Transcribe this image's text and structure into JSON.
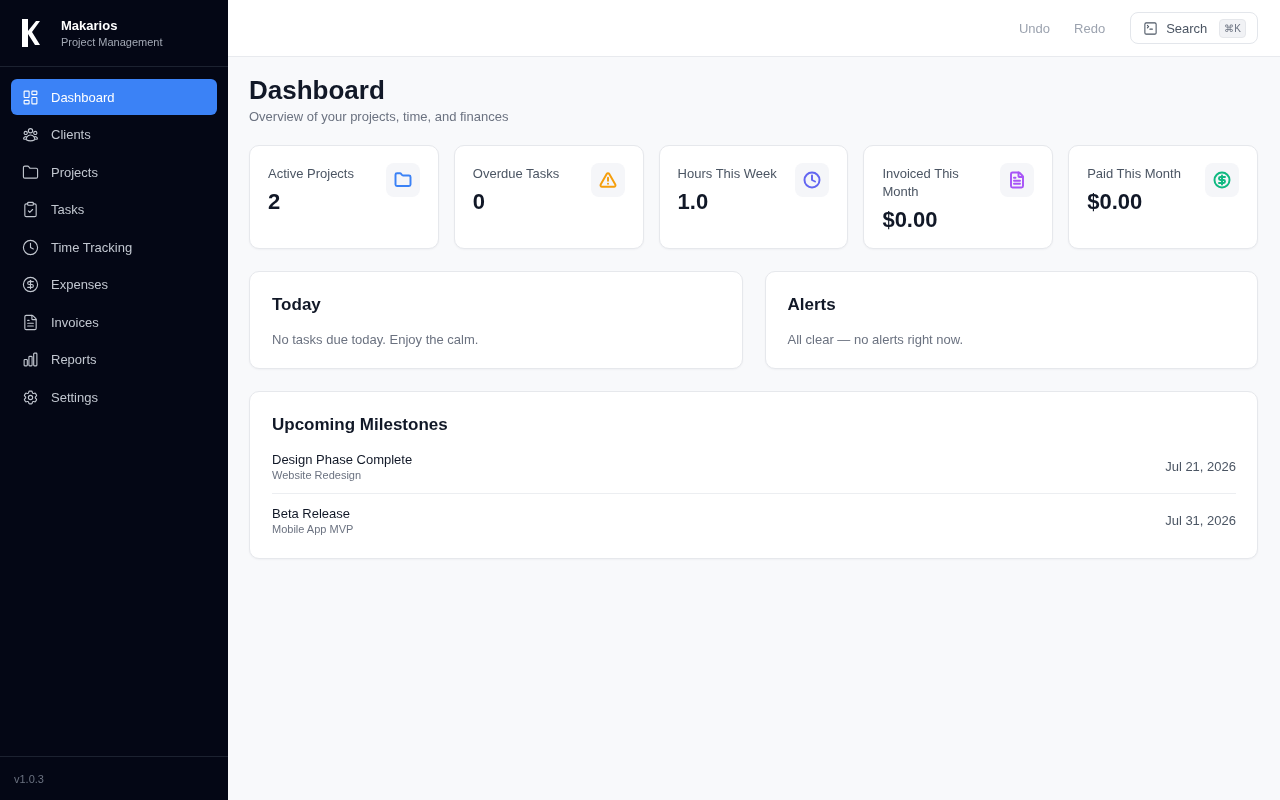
{
  "sidebar": {
    "brand": {
      "name": "Makarios",
      "subtitle": "Project Management"
    },
    "items": [
      {
        "label": "Dashboard",
        "kind": "dashboard",
        "selected": true
      },
      {
        "label": "Clients",
        "kind": "clients",
        "selected": false
      },
      {
        "label": "Projects",
        "kind": "projects",
        "selected": false
      },
      {
        "label": "Tasks",
        "kind": "tasks",
        "selected": false
      },
      {
        "label": "Time Tracking",
        "kind": "time",
        "selected": false
      },
      {
        "label": "Expenses",
        "kind": "expenses",
        "selected": false
      },
      {
        "label": "Invoices",
        "kind": "invoices",
        "selected": false
      },
      {
        "label": "Reports",
        "kind": "reports",
        "selected": false
      },
      {
        "label": "Settings",
        "kind": "settings",
        "selected": false
      }
    ],
    "version": "v1.0.3"
  },
  "topbar": {
    "undo": {
      "label": "Undo",
      "disabled": true
    },
    "redo": {
      "label": "Redo",
      "disabled": true
    },
    "search": {
      "label": "Search",
      "shortcut": "⌘K"
    }
  },
  "page": {
    "title": "Dashboard",
    "subtitle": "Overview of your projects, time, and finances"
  },
  "stats": [
    {
      "label": "Active Projects",
      "value": "2",
      "kind": "projects",
      "color": "#3b82f6"
    },
    {
      "label": "Overdue Tasks",
      "value": "0",
      "kind": "overdue",
      "color": "#f59e0b"
    },
    {
      "label": "Hours This Week",
      "value": "1.0",
      "kind": "hours",
      "color": "#6366f1"
    },
    {
      "label": "Invoiced This Month",
      "value": "$0.00",
      "kind": "invoiced",
      "color": "#a855f7"
    },
    {
      "label": "Paid This Month",
      "value": "$0.00",
      "kind": "paid",
      "color": "#10b981"
    }
  ],
  "panels": [
    {
      "title": "Today",
      "message": "No tasks due today. Enjoy the calm."
    },
    {
      "title": "Alerts",
      "message": "All clear — no alerts right now."
    }
  ],
  "milestones": {
    "title": "Upcoming Milestones",
    "items": [
      {
        "name": "Design Phase Complete",
        "project": "Website Redesign",
        "date": "Jul 21, 2026"
      },
      {
        "name": "Beta Release",
        "project": "Mobile App MVP",
        "date": "Jul 31, 2026"
      }
    ]
  }
}
